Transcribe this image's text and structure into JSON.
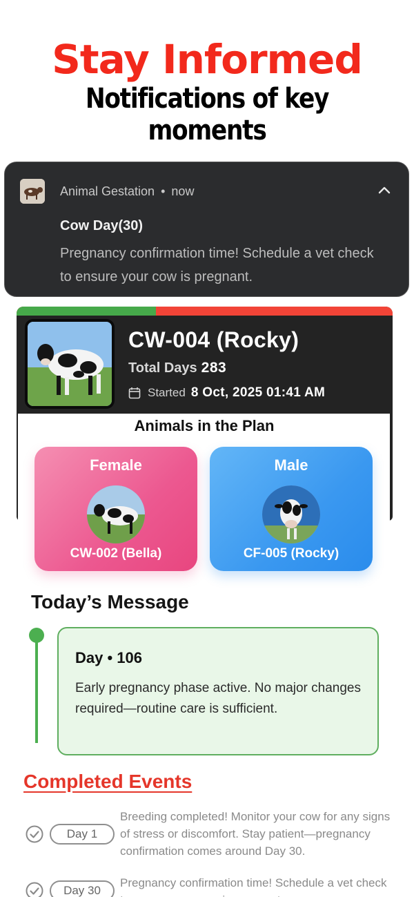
{
  "headline": "Stay Informed",
  "subheadline": "Notifications of key moments",
  "notification": {
    "app_name": "Animal Gestation",
    "separator": "•",
    "time": "now",
    "title": "Cow Day(30)",
    "body": "Pregnancy confirmation time! Schedule a vet check to ensure your cow is pregnant.",
    "icon": "cow-icon",
    "expand_icon": "chevron-up-icon"
  },
  "plan": {
    "progress_fraction": 0.37,
    "progress_colors": {
      "done": "#46a94a",
      "remaining": "#f24437"
    },
    "title": "CW-004 (Rocky)",
    "total_days_label": "Total Days",
    "total_days_value": "283",
    "started_label": "Started",
    "started_value": "8 Oct, 2025 01:41 AM",
    "calendar_icon": "calendar-icon",
    "animals_title": "Animals in the Plan",
    "female": {
      "label": "Female",
      "tag": "CW-002 (Bella)"
    },
    "male": {
      "label": "Male",
      "tag": "CF-005 (Rocky)"
    }
  },
  "today": {
    "section_title": "Today’s Message",
    "day_label": "Day • 106",
    "message": "Early pregnancy phase active. No major changes required—routine care is sufficient.",
    "accent_color": "#4caf50"
  },
  "completed": {
    "section_title": "Completed Events",
    "accent_color": "#e5362a",
    "events": [
      {
        "day": "Day 1",
        "text": "Breeding completed! Monitor your cow for any signs of stress or discomfort. Stay patient—pregnancy confirmation comes around Day 30."
      },
      {
        "day": "Day 30",
        "text": "Pregnancy confirmation time! Schedule a vet check to ensure your cow is pregnant."
      }
    ]
  }
}
